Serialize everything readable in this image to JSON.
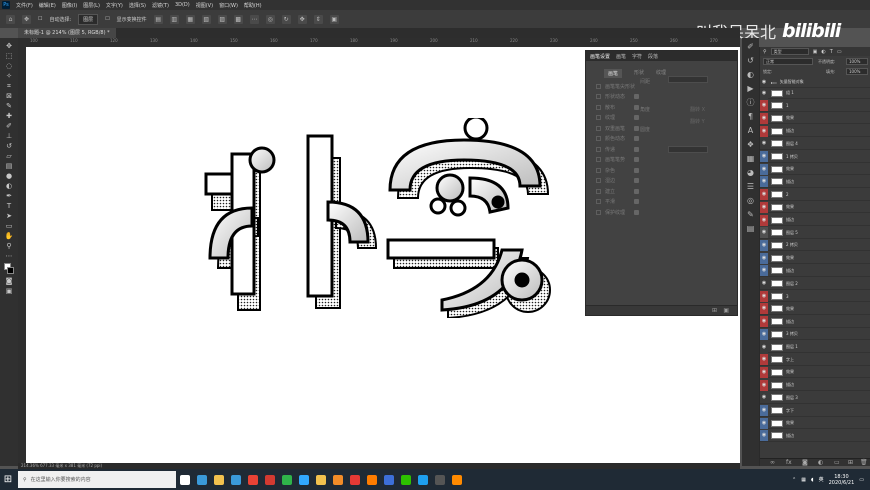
{
  "menu": {
    "app_icon": "Ps",
    "items": [
      "文件(F)",
      "编辑(E)",
      "图像(I)",
      "图层(L)",
      "文字(Y)",
      "选择(S)",
      "滤镜(T)",
      "3D(D)",
      "视图(V)",
      "窗口(W)",
      "帮助(H)"
    ]
  },
  "options": {
    "auto_select": "自动选择:",
    "layer_target": "图层",
    "show_transform": "显示变换控件"
  },
  "document": {
    "tab_title": "未标题-1 @ 214% (图层 5, RGB/8) *",
    "status": "214.36%    677.33 毫米 x 381 毫米 (72 ppi)"
  },
  "ruler": {
    "ticks": [
      "100",
      "110",
      "120",
      "130",
      "140",
      "150",
      "160",
      "170",
      "180",
      "190",
      "200",
      "210",
      "220",
      "230",
      "240",
      "250",
      "260",
      "270"
    ]
  },
  "tools": [
    "move-icon",
    "marquee-icon",
    "lasso-icon",
    "magic-wand-icon",
    "crop-icon",
    "frame-icon",
    "eyedropper-icon",
    "healing-icon",
    "brush-icon",
    "stamp-icon",
    "history-brush-icon",
    "eraser-icon",
    "gradient-icon",
    "blur-icon",
    "dodge-icon",
    "pen-icon",
    "type-icon",
    "path-select-icon",
    "rectangle-icon",
    "hand-icon",
    "zoom-icon",
    "more-icon"
  ],
  "properties": {
    "tabs": [
      "画笔设置",
      "画笔",
      "字符",
      "段落"
    ],
    "active_button": "画笔",
    "second_tab": "形状",
    "third_tab": "纹理",
    "options": [
      "画笔笔尖形状",
      "形状动态",
      "散布",
      "纹理",
      "双重画笔",
      "颜色动态",
      "传递",
      "画笔笔势",
      "杂色",
      "湿边",
      "建立",
      "平滑",
      "保护纹理"
    ],
    "right_labels": [
      "间距",
      "角度",
      "圆度",
      "翻转 X",
      "翻转 Y"
    ]
  },
  "layers": {
    "kind_filter": "类型",
    "blend_mode": "正常",
    "opacity_label": "不透明度:",
    "opacity_value": "100%",
    "lock_label": "锁定:",
    "fill_label": "填充:",
    "fill_value": "100%",
    "group_name": "矢量智能对象",
    "rows": [
      {
        "name": "组 1",
        "color": "#3b3b3b"
      },
      {
        "name": "1",
        "color": "#b03a3a"
      },
      {
        "name": "效果",
        "color": "#b03a3a"
      },
      {
        "name": "描边",
        "color": "#b03a3a"
      },
      {
        "name": "图层 4",
        "color": "#3b3b3b"
      },
      {
        "name": "1 拷贝",
        "color": "#4a6b9a"
      },
      {
        "name": "效果",
        "color": "#4a6b9a"
      },
      {
        "name": "描边",
        "color": "#4a6b9a"
      },
      {
        "name": "2",
        "color": "#b03a3a"
      },
      {
        "name": "效果",
        "color": "#b03a3a"
      },
      {
        "name": "描边",
        "color": "#b03a3a"
      },
      {
        "name": "图层 5",
        "color": "#505050"
      },
      {
        "name": "2 拷贝",
        "color": "#4a6b9a"
      },
      {
        "name": "效果",
        "color": "#4a6b9a"
      },
      {
        "name": "描边",
        "color": "#4a6b9a"
      },
      {
        "name": "图层 2",
        "color": "#3b3b3b"
      },
      {
        "name": "3",
        "color": "#b03a3a"
      },
      {
        "name": "效果",
        "color": "#b03a3a"
      },
      {
        "name": "描边",
        "color": "#b03a3a"
      },
      {
        "name": "3 拷贝",
        "color": "#4a6b9a"
      },
      {
        "name": "图层 1",
        "color": "#3b3b3b"
      },
      {
        "name": "字上",
        "color": "#b03a3a"
      },
      {
        "name": "效果",
        "color": "#b03a3a"
      },
      {
        "name": "描边",
        "color": "#b03a3a"
      },
      {
        "name": "图层 3",
        "color": "#3b3b3b"
      },
      {
        "name": "字下",
        "color": "#4a6b9a"
      },
      {
        "name": "效果",
        "color": "#4a6b9a"
      },
      {
        "name": "描边",
        "color": "#4a6b9a"
      }
    ]
  },
  "watermark": {
    "text": "叫我呆呆北",
    "logo": "bilibili"
  },
  "taskbar": {
    "search_placeholder": "在这里输入你要搜索的内容",
    "ime": "英",
    "time": "18:30",
    "date": "2020/6/21",
    "apps": [
      {
        "name": "task-view",
        "color": "#ffffff"
      },
      {
        "name": "edge",
        "color": "#3a9ad9"
      },
      {
        "name": "explorer",
        "color": "#f2c14e"
      },
      {
        "name": "store",
        "color": "#3a9ad9"
      },
      {
        "name": "chrome",
        "color": "#e94235"
      },
      {
        "name": "netease-music",
        "color": "#d33a31"
      },
      {
        "name": "app-green",
        "color": "#2fb34a"
      },
      {
        "name": "photoshop",
        "color": "#31a8ff"
      },
      {
        "name": "folder",
        "color": "#f2c14e"
      },
      {
        "name": "media",
        "color": "#f28c28"
      },
      {
        "name": "red-app",
        "color": "#e53935"
      },
      {
        "name": "illustrator",
        "color": "#ff7c00"
      },
      {
        "name": "app-blue",
        "color": "#3d6fd8"
      },
      {
        "name": "wechat",
        "color": "#2dc100"
      },
      {
        "name": "qq",
        "color": "#1ea0f0"
      },
      {
        "name": "app-dark",
        "color": "#555555"
      },
      {
        "name": "app-orange",
        "color": "#ff8a00"
      }
    ]
  }
}
